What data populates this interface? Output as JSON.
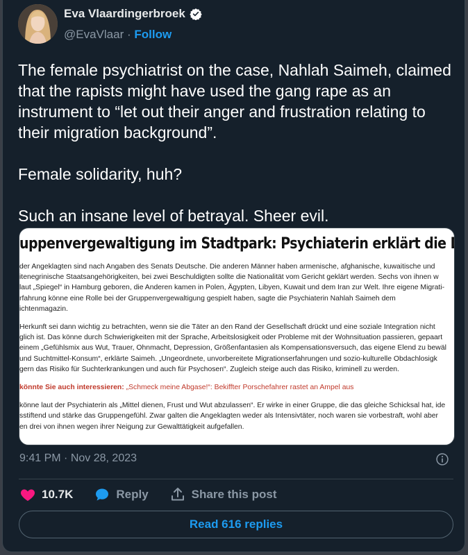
{
  "author": {
    "name": "Eva Vlaardingerbroek",
    "handle": "@EvaVlaar",
    "separator": "·",
    "follow_label": "Follow"
  },
  "tweet": {
    "paragraphs": [
      "The female psychiatrist on the case, Nahlah Saimeh, claimed that the rapists might have used the gang rape as an instrument to “let out their anger and frustration relating to their migration background”.",
      "Female solidarity, huh?",
      "Such an insane level of betrayal. Sheer evil."
    ]
  },
  "media": {
    "title": "uppenvergewaltigung im Stadtpark: Psychiaterin erklärt die Dynamik",
    "body": [
      "der Angeklagten sind nach Angaben des Senats Deutsche. Die anderen Männer haben armenische, afghanische, kuwaitische und\nitenegrinische Staatsangehörigkeiten, bei zwei Beschuldigten sollte die Nationalität vom Gericht geklärt werden. Sechs von ihnen w\nlaut „Spiegel“ in Hamburg geboren, die Anderen kamen in Polen, Ägypten, Libyen, Kuwait und dem Iran zur Welt. Ihre eigene Migrati-\nrfahrung könne eine Rolle bei der Gruppenvergewaltigung gespielt haben, sagte die Psychiaterin Nahlah Saimeh dem\nichtenmagazin.",
      "Herkunft sei dann wichtig zu betrachten, wenn sie die Täter an den Rand der Gesellschaft drückt und eine soziale Integration nicht\nglich ist. Das könne durch Schwierigkeiten mit der Sprache, Arbeitslosigkeit oder Probleme mit der Wohnsituation passieren, gepaart\neinem „Gefühlsmix aus Wut, Trauer, Ohnmacht, Depression, Größenfantasien als Kompensationsversuch, das eigene Elend zu bewäl\n und Suchtmittel-Konsum“, erklärte Saimeh. „Ungeordnete, unvorbereitete Migrationserfahrungen und sozio-kulturelle Obdachlosigk\ngern das Risiko für Suchterkrankungen und auch für Psychosen“. Zugleich steige auch das Risiko, kriminell zu werden."
    ],
    "related_label": "könnte Sie auch interessieren:",
    "related_link": "„Schmeck meine Abgase!“: Bekiffter Porschefahrer rastet an Ampel aus",
    "body_after": "könne laut der Psychiaterin als „Mittel dienen, Frust und Wut abzulassen“. Er wirke in einer Gruppe, die das gleiche Schicksal hat, ide\nsstiftend und stärke das Gruppengefühl. Zwar galten die Angeklagten weder als Intensivtäter, noch waren sie vorbestraft, wohl aber\nen drei von ihnen wegen ihrer Neigung zur Gewalttätigkeit aufgefallen."
  },
  "meta": {
    "time": "9:41 PM",
    "separator": "·",
    "date": "Nov 28, 2023"
  },
  "actions": {
    "likes": "10.7K",
    "reply_label": "Reply",
    "share_label": "Share this post"
  },
  "replies_button": "Read 616 replies",
  "colors": {
    "background": "#15202b",
    "accent": "#1d9bf0",
    "like": "#f91880",
    "muted": "#8b98a5"
  },
  "icons": [
    "verified-badge-icon",
    "info-icon",
    "heart-icon",
    "reply-bubble-icon",
    "share-icon"
  ]
}
